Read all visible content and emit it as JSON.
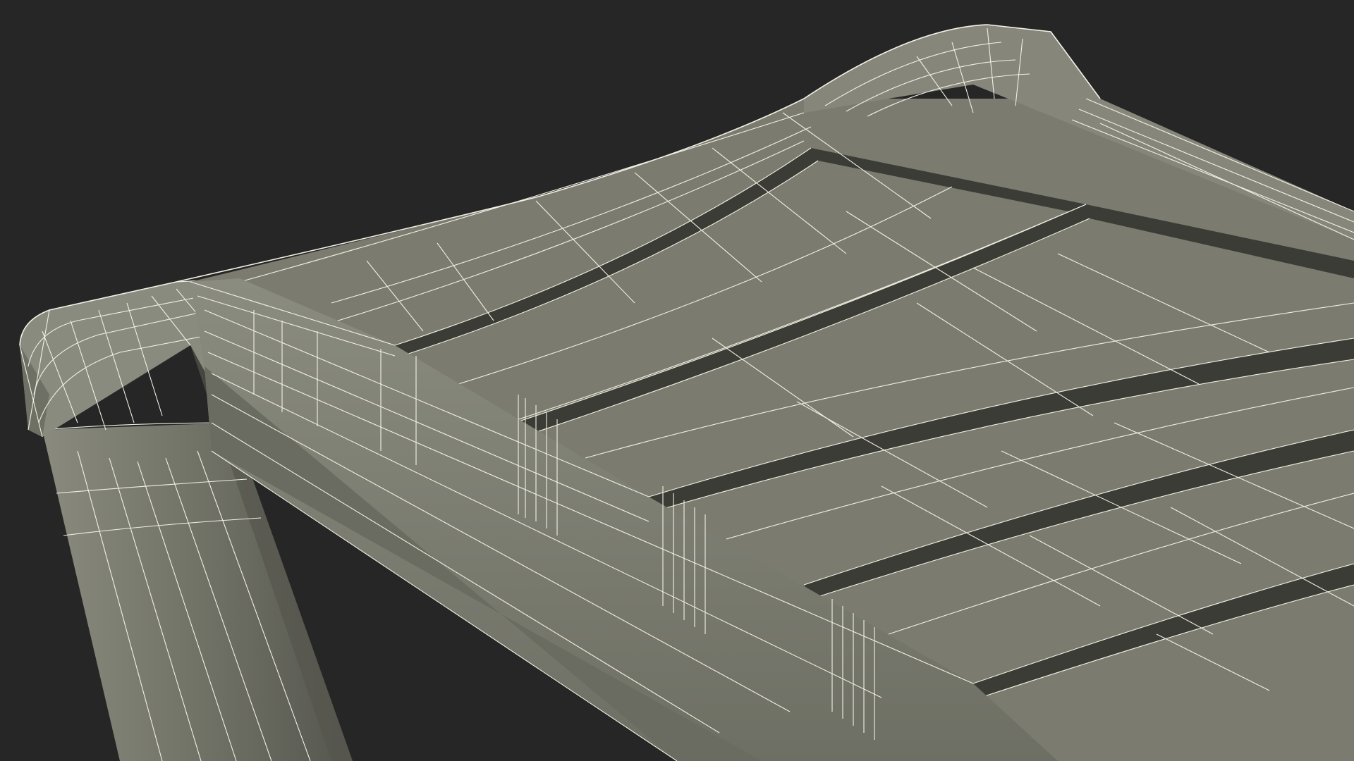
{
  "scene": {
    "background_color": "#262626",
    "mesh_fill_color": "#7b7c6f",
    "mesh_shadow_color": "#4e4f47",
    "groove_color": "#3b3c36",
    "wire_color": "#f2f0e4"
  }
}
